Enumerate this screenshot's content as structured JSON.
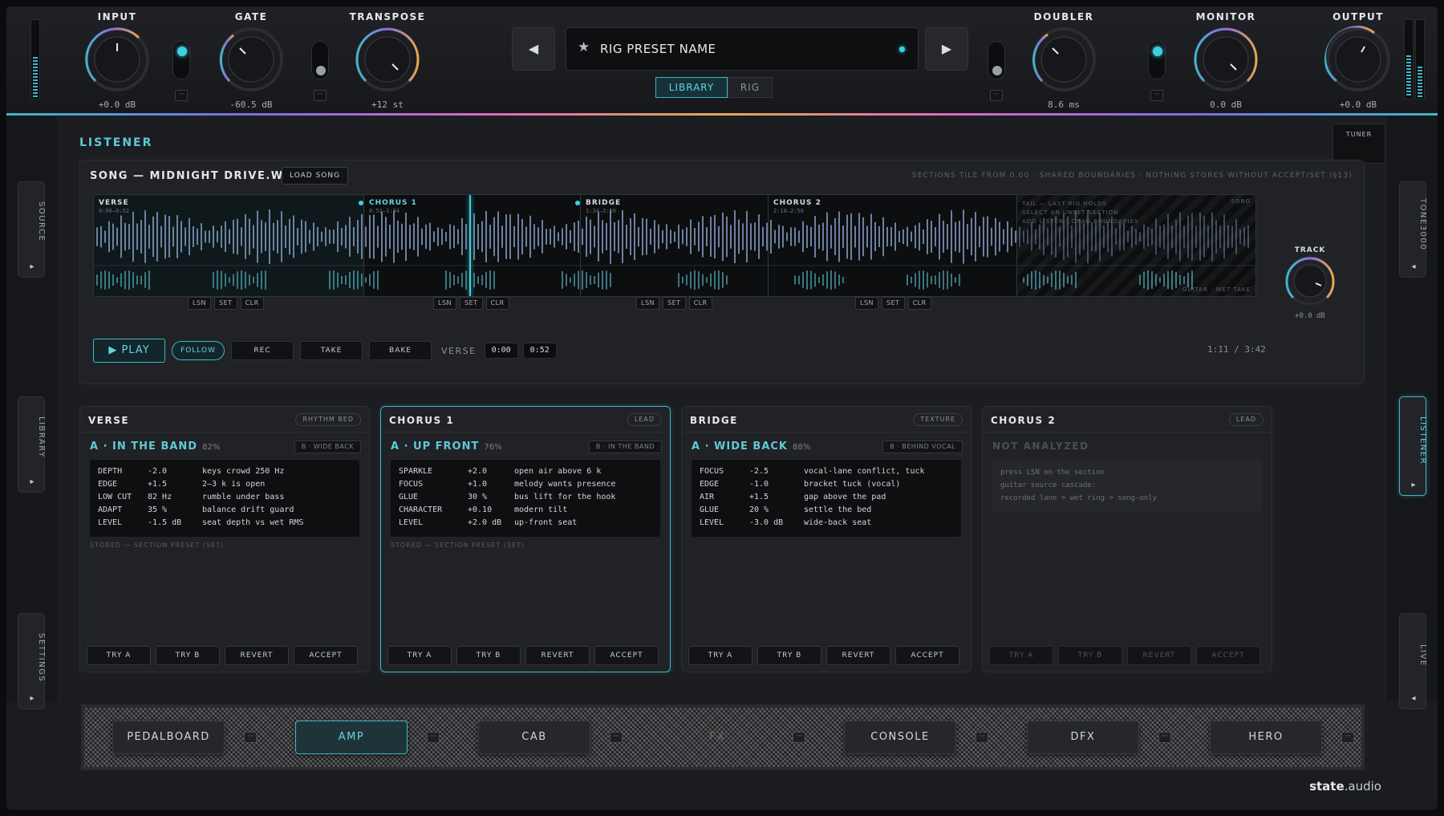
{
  "topbar": {
    "knobs": {
      "input": {
        "label": "INPUT",
        "value": "+0.0 dB"
      },
      "gate": {
        "label": "GATE",
        "value": "-60.5 dB"
      },
      "transpose": {
        "label": "TRANSPOSE",
        "value": "+12 st"
      },
      "doubler": {
        "label": "DOUBLER",
        "value": "8.6 ms"
      },
      "monitor": {
        "label": "MONITOR",
        "value": "0.0 dB"
      },
      "output": {
        "label": "OUTPUT",
        "value": "+0.0 dB"
      }
    },
    "preset_name": "RIG PRESET NAME",
    "prev_icon": "◀",
    "next_icon": "▶",
    "star_icon": "★",
    "more_label": "···",
    "tabs": {
      "library": "LIBRARY",
      "rig": "RIG"
    },
    "accent_color": "#3fb6c9"
  },
  "left_tabs": [
    {
      "label": "SOURCE",
      "arrow": "▸"
    },
    {
      "label": "LIBRARY",
      "arrow": "▸"
    },
    {
      "label": "SETTINGS",
      "arrow": "▸"
    }
  ],
  "right_tabs": [
    {
      "label": "TONE3000",
      "arrow": "◂"
    },
    {
      "label": "LISTENER",
      "arrow": "▸"
    },
    {
      "label": "LIVE",
      "arrow": "◂"
    }
  ],
  "listener": {
    "title": "LISTENER",
    "tuner": "TUNER",
    "song_title": "SONG — MIDNIGHT DRIVE.WAV",
    "load_song": "LOAD SONG",
    "hint": "SECTIONS TILE FROM 0.00 · SHARED BOUNDARIES · NOTHING STORES WITHOUT ACCEPT/SET (§13)",
    "sections": [
      {
        "name": "VERSE",
        "range": "0:00–0:52"
      },
      {
        "name": "CHORUS 1",
        "range": "0:52–1:34"
      },
      {
        "name": "BRIDGE",
        "range": "1:34–2:10"
      },
      {
        "name": "CHORUS 2",
        "range": "2:10–2:58"
      }
    ],
    "tail_lines": [
      "TAIL — LAST RIG HOLDS",
      "SELECT AN UNSET SECTION",
      "ADD LISTEN · DRAG BOUNDARIES"
    ],
    "song_tag": "SONG",
    "lane_tag": "GUITAR · WET TAKE",
    "seg_buttons": [
      "LSN",
      "SET",
      "CLR"
    ],
    "track": {
      "label": "TRACK",
      "value": "+0.0 dB"
    },
    "transport": {
      "play": "▶ PLAY",
      "follow": "FOLLOW",
      "rec": "REC",
      "take": "TAKE",
      "bake": "BAKE",
      "section": "VERSE",
      "start": "0:00",
      "end": "0:52",
      "clock": "1:11 / 3:42"
    }
  },
  "cards": [
    {
      "name": "VERSE",
      "role": "RHYTHM BED",
      "option": "A · IN THE BAND",
      "pct": "82%",
      "alt": "B · WIDE BACK",
      "params": [
        {
          "k": "DEPTH",
          "v": "-2.0",
          "d": "keys crowd 250 Hz"
        },
        {
          "k": "EDGE",
          "v": "+1.5",
          "d": "2–3 k is open"
        },
        {
          "k": "LOW CUT",
          "v": "82 Hz",
          "d": "rumble under bass"
        },
        {
          "k": "ADAPT",
          "v": "35 %",
          "d": "balance drift guard"
        },
        {
          "k": "LEVEL",
          "v": "-1.5 dB",
          "d": "seat depth vs wet RMS"
        }
      ],
      "stored": "STORED — SECTION PRESET (SET)"
    },
    {
      "name": "CHORUS 1",
      "role": "LEAD",
      "option": "A · UP FRONT",
      "pct": "76%",
      "alt": "B · IN THE BAND",
      "params": [
        {
          "k": "SPARKLE",
          "v": "+2.0",
          "d": "open air above 6 k"
        },
        {
          "k": "FOCUS",
          "v": "+1.0",
          "d": "melody wants presence"
        },
        {
          "k": "GLUE",
          "v": "30 %",
          "d": "bus lift for the hook"
        },
        {
          "k": "CHARACTER",
          "v": "+0.10",
          "d": "modern tilt"
        },
        {
          "k": "LEVEL",
          "v": "+2.0 dB",
          "d": "up-front seat"
        }
      ],
      "stored": "STORED — SECTION PRESET (SET)"
    },
    {
      "name": "BRIDGE",
      "role": "TEXTURE",
      "option": "A · WIDE BACK",
      "pct": "88%",
      "alt": "B · BEHIND VOCAL",
      "params": [
        {
          "k": "FOCUS",
          "v": "-2.5",
          "d": "vocal-lane conflict, tuck"
        },
        {
          "k": "EDGE",
          "v": "-1.0",
          "d": "bracket tuck (vocal)"
        },
        {
          "k": "AIR",
          "v": "+1.5",
          "d": "gap above the pad"
        },
        {
          "k": "GLUE",
          "v": "20 %",
          "d": "settle the bed"
        },
        {
          "k": "LEVEL",
          "v": "-3.0 dB",
          "d": "wide-back seat"
        }
      ],
      "stored": ""
    }
  ],
  "card4": {
    "name": "CHORUS 2",
    "role": "LEAD",
    "not_analyzed": "NOT ANALYZED",
    "lines": [
      "press LSN on the section",
      "guitar source cascade:",
      "recorded lane > wet ring > song-only"
    ]
  },
  "card_actions": [
    "TRY A",
    "TRY B",
    "REVERT",
    "ACCEPT"
  ],
  "modules": [
    {
      "label": "PEDALBOARD"
    },
    {
      "label": "AMP"
    },
    {
      "label": "CAB"
    },
    {
      "label": "FX"
    },
    {
      "label": "CONSOLE"
    },
    {
      "label": "DFX"
    },
    {
      "label": "HERO"
    }
  ],
  "brand": {
    "a": "state",
    "b": ".audio"
  }
}
